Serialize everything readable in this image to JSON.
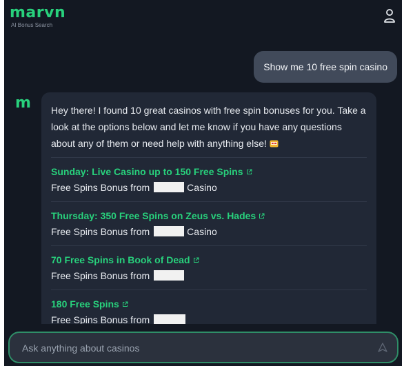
{
  "header": {
    "logo": "marvn",
    "tagline": "AI Bonus Search",
    "user_icon": "user-icon"
  },
  "conversation": {
    "user_message": "Show me 10 free spin casino",
    "bot_avatar": "m",
    "bot_intro": "Hey there! I found 10 great casinos with free spin bonuses for you. Take a look at the options below and let me know if you have any questions about any of them or need help with anything else!",
    "bot_intro_emoji": "slot-machine-emoji",
    "offers": [
      {
        "title": "Sunday: Live Casino up to 150 Free Spins",
        "sub_prefix": "Free Spins Bonus from",
        "sub_suffix": "Casino"
      },
      {
        "title": "Thursday: 350 Free Spins on Zeus vs. Hades",
        "sub_prefix": "Free Spins Bonus from",
        "sub_suffix": "Casino"
      },
      {
        "title": "70 Free Spins in Book of Dead",
        "sub_prefix": "Free Spins Bonus from",
        "sub_suffix": ""
      },
      {
        "title": "180 Free Spins",
        "sub_prefix": "Free Spins Bonus from",
        "sub_suffix": ""
      }
    ]
  },
  "composer": {
    "placeholder": "Ask anything about casinos",
    "send_icon": "send-icon"
  },
  "colors": {
    "background": "#131822",
    "accent": "#28d17c",
    "card": "#212836",
    "user_bubble": "#414a5a",
    "input_border": "#2f8e68"
  }
}
